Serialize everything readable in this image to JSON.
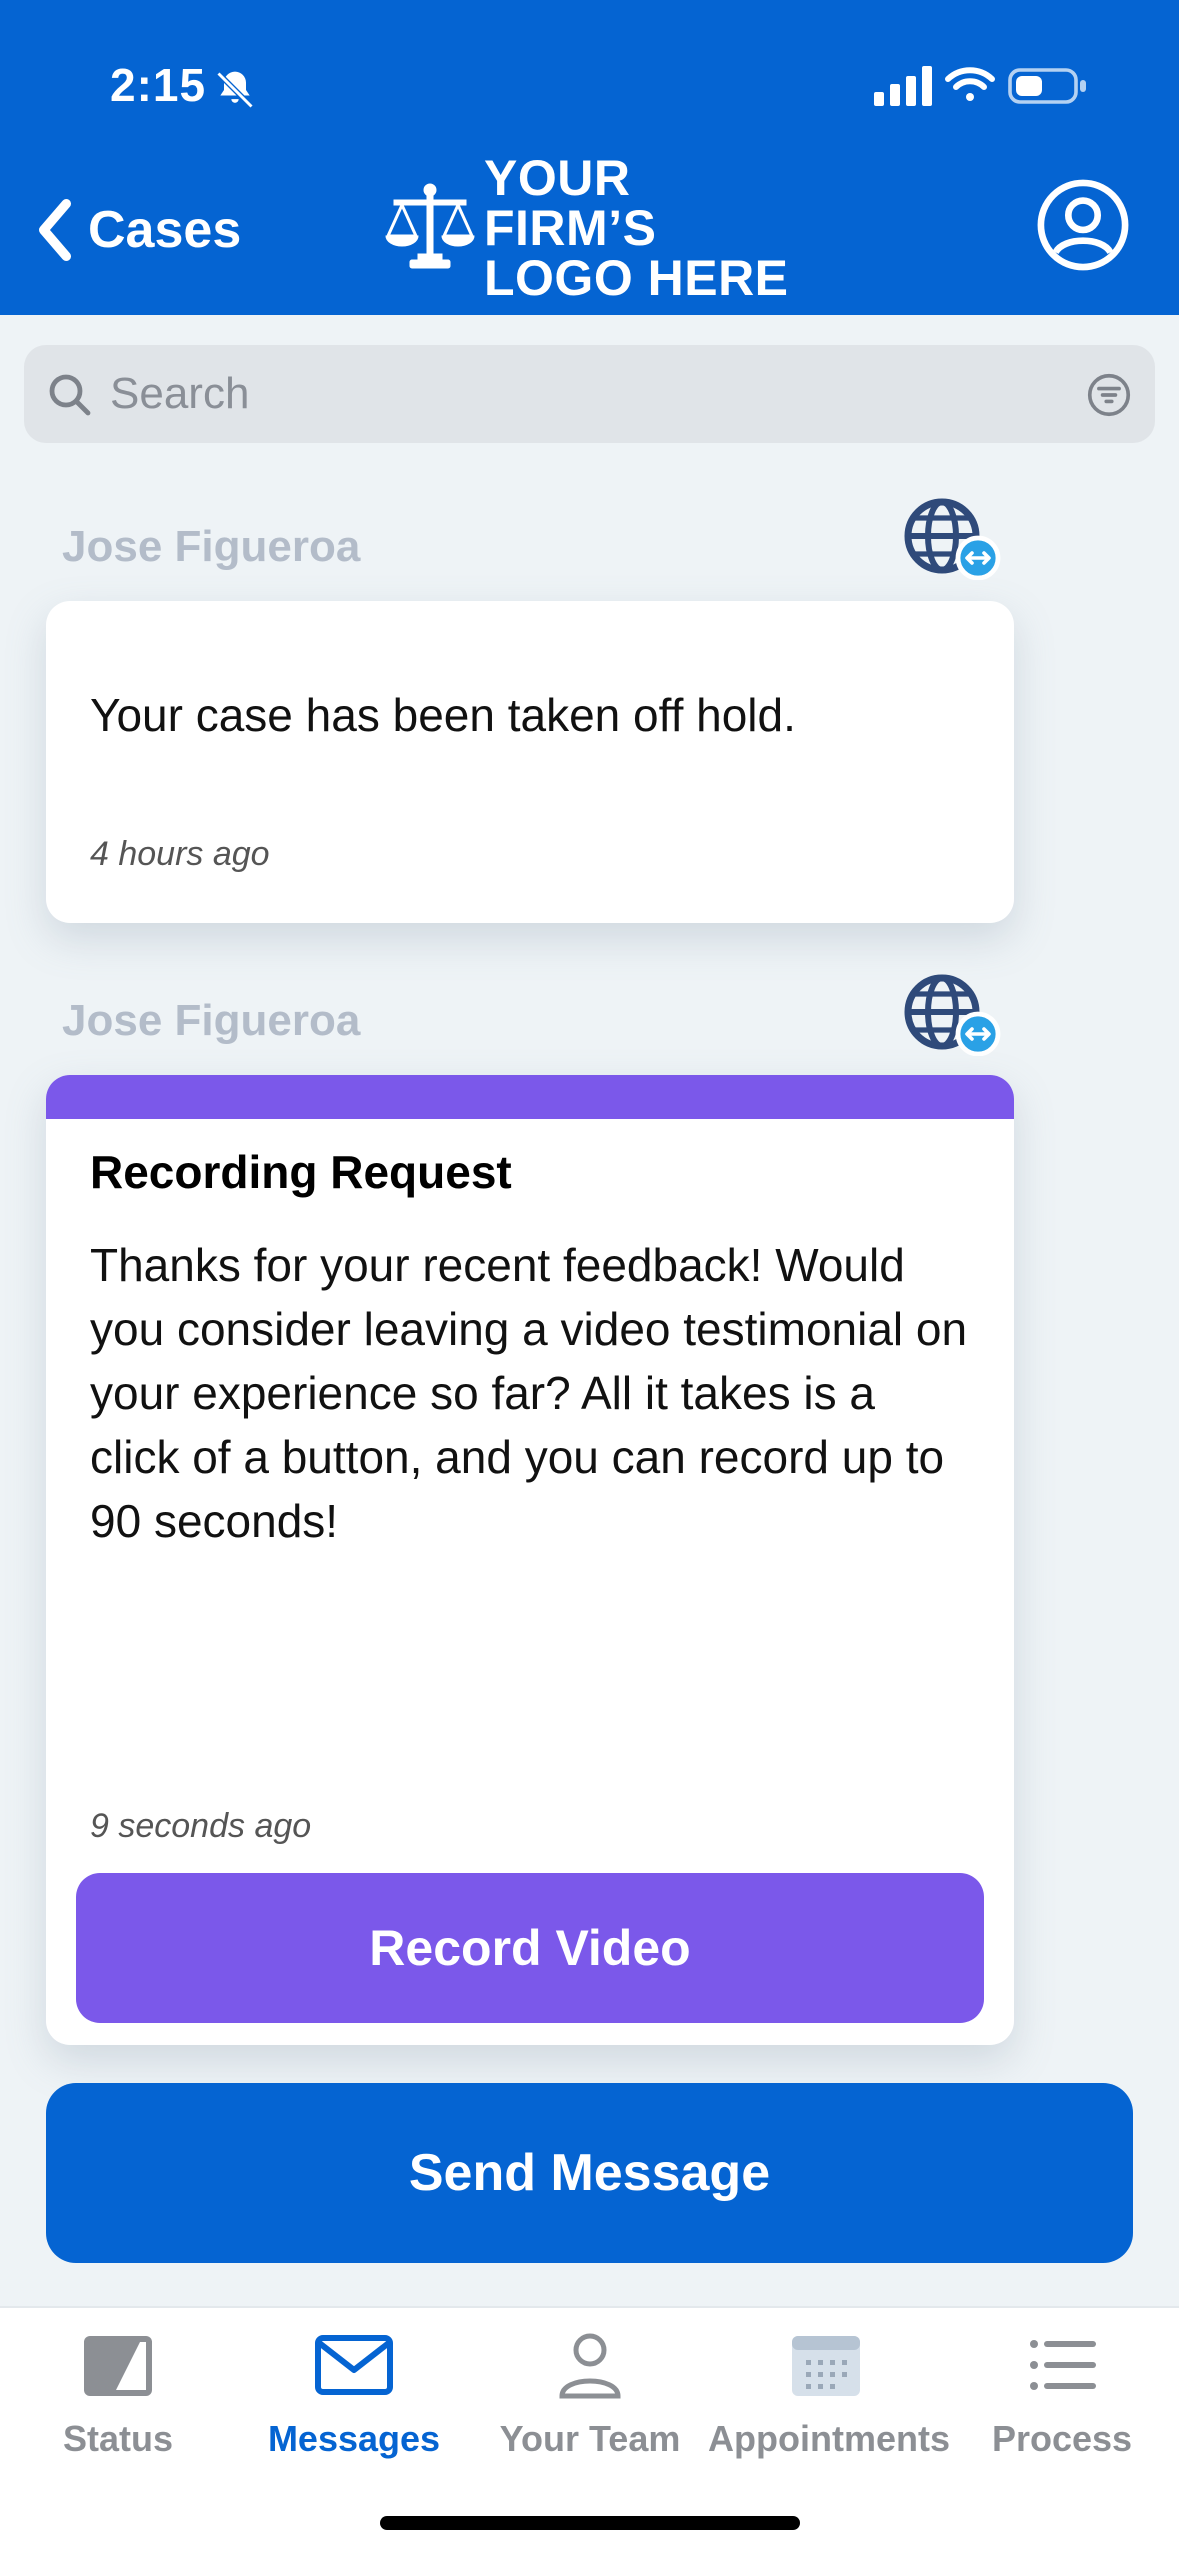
{
  "status_bar": {
    "time": "2:15",
    "icons": [
      "bell-slash-icon",
      "cellular-signal-icon",
      "wifi-icon",
      "battery-icon"
    ]
  },
  "header": {
    "back_label": "Cases",
    "logo_line1": "YOUR FIRM’S",
    "logo_line2": "LOGO HERE",
    "profile_icon": "user-circle-icon",
    "background": "#0564d2"
  },
  "search": {
    "placeholder": "Search",
    "filter_icon": "filter-icon"
  },
  "messages": [
    {
      "sender": "Jose Figueroa",
      "body": "Your case has been taken off hold.",
      "time": "4 hours ago",
      "icon": "translate-globe-icon"
    },
    {
      "sender": "Jose Figueroa",
      "title": "Recording Request",
      "body": "Thanks for your recent feedback! Would you consider leaving a video testimonial on your experience so far? All it takes is a click of a button, and you can record up to 90 seconds!",
      "time": "9 seconds ago",
      "action_label": "Record Video",
      "accent": "#7b58ea",
      "icon": "translate-globe-icon"
    }
  ],
  "send_button_label": "Send Message",
  "tabs": [
    {
      "label": "Status",
      "icon": "status-icon",
      "active": false
    },
    {
      "label": "Messages",
      "icon": "envelope-icon",
      "active": true
    },
    {
      "label": "Your Team",
      "icon": "person-icon",
      "active": false
    },
    {
      "label": "Appointments",
      "icon": "calendar-icon",
      "active": false
    },
    {
      "label": "Process",
      "icon": "list-icon",
      "active": false
    }
  ]
}
